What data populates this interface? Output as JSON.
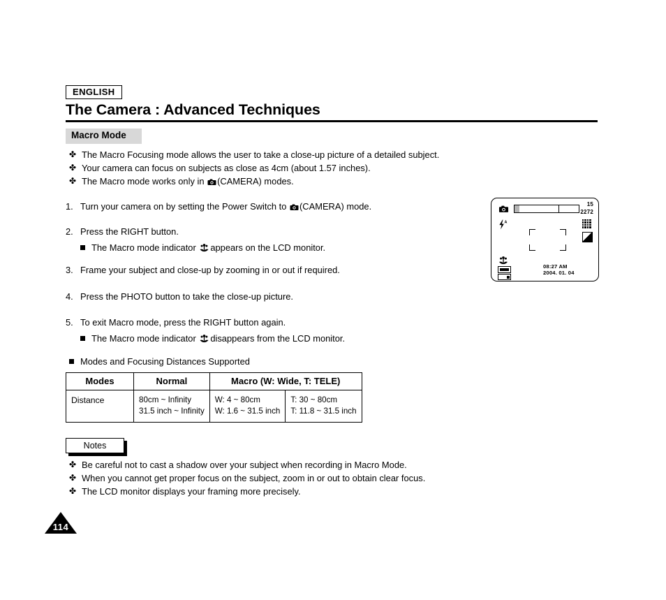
{
  "header": {
    "language_badge": "ENGLISH",
    "chapter_title": "The Camera : Advanced Techniques",
    "section_title": "Macro Mode"
  },
  "intro_bullets": [
    {
      "mark": "✤",
      "text_before": "The Macro Focusing mode allows the user to take a close-up picture of a detailed subject.",
      "icon": "",
      "text_after": ""
    },
    {
      "mark": "✤",
      "text_before": "Your camera can focus on subjects as close as 4cm (about 1.57 inches).",
      "icon": "",
      "text_after": ""
    },
    {
      "mark": "✤",
      "text_before": "The Macro mode works only in ",
      "icon": "camera-icon",
      "text_after": "(CAMERA) modes."
    }
  ],
  "steps": [
    {
      "num": "1.",
      "text_before": "Turn your camera on by setting the Power Switch to ",
      "icon": "camera-icon",
      "text_after": "(CAMERA) mode.",
      "sub": null
    },
    {
      "num": "2.",
      "text_before": "Press the RIGHT button.",
      "icon": "",
      "text_after": "",
      "sub": {
        "text_before": "The Macro mode indicator ",
        "icon": "macro-flower-icon",
        "text_after": "appears on the LCD monitor."
      }
    },
    {
      "num": "3.",
      "text_before": "Frame your subject and close-up by zooming in or out if required.",
      "icon": "",
      "text_after": "",
      "sub": null
    },
    {
      "num": "4.",
      "text_before": "Press the PHOTO  button to take the close-up picture.",
      "icon": "",
      "text_after": "",
      "sub": null
    },
    {
      "num": "5.",
      "text_before": "To exit Macro mode, press the RIGHT button again.",
      "icon": "",
      "text_after": "",
      "sub": {
        "text_before": "The Macro mode indicator ",
        "icon": "macro-flower-icon",
        "text_after": "disappears from the LCD monitor."
      }
    }
  ],
  "table_heading": "Modes and Focusing Distances Supported",
  "table": {
    "headers": [
      "Modes",
      "Normal",
      "Macro (W: Wide, T: TELE)"
    ],
    "row_label": "Distance",
    "normal": [
      "80cm ~ Infinity",
      "31.5 inch ~ Infinity"
    ],
    "macro_wide": [
      "W: 4 ~ 80cm",
      "W: 1.6 ~ 31.5 inch"
    ],
    "macro_tele": [
      "T: 30 ~ 80cm",
      "T: 11.8 ~ 31.5 inch"
    ]
  },
  "notes": {
    "label": "Notes",
    "bullets": [
      {
        "mark": "✤",
        "text": "Be careful not to cast a shadow over your subject when recording in Macro Mode."
      },
      {
        "mark": "✤",
        "text": "When you cannot get proper focus on the subject, zoom in or out to obtain clear focus."
      },
      {
        "mark": "✤",
        "text": "The LCD monitor displays your framing more precisely."
      }
    ]
  },
  "lcd_display": {
    "counter": "15",
    "resolution": "2272",
    "time": "08:27 AM",
    "date": "2004. 01. 04",
    "flash_mode": "A",
    "icons": [
      "record-camera-icon",
      "flash-auto-icon",
      "quality-grid-icon",
      "quality-level-icon",
      "macro-flower-icon",
      "battery-icon",
      "memory-card-icon"
    ]
  },
  "page_number": "114"
}
